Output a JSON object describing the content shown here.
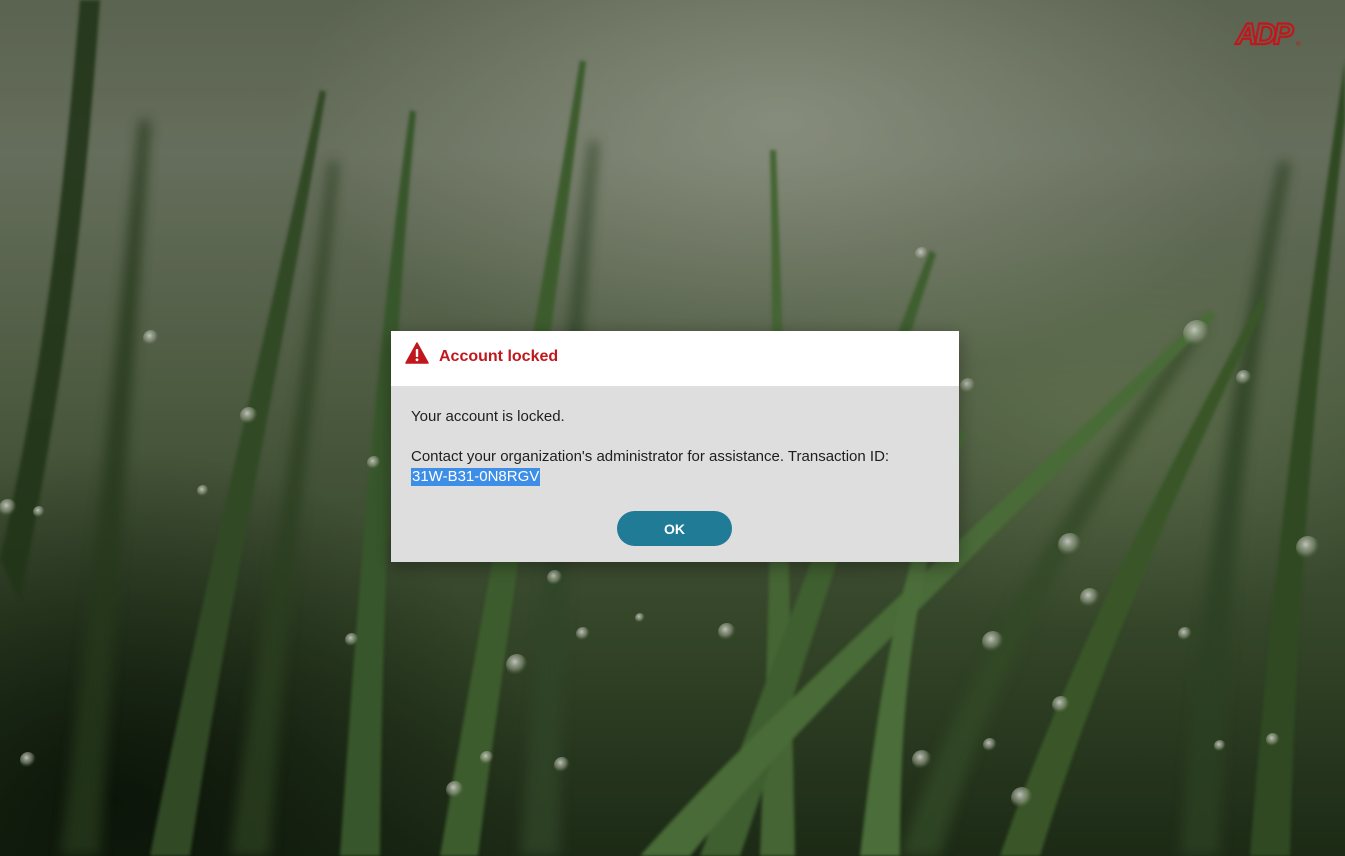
{
  "branding": {
    "logo_text": "ADP",
    "logo_color": "#c0171d"
  },
  "background": {
    "description_icon": "grass-dew-photo"
  },
  "dialog": {
    "icon": "warning-triangle-icon",
    "title": "Account locked",
    "title_color": "#c0171d",
    "message_line_1": "Your account is locked.",
    "message_line_2": "Contact your organization's administrator for assistance. Transaction ID:",
    "transaction_id": "31W-B31-0N8RGV",
    "ok_label": "OK",
    "button_color": "#1f7b96"
  }
}
